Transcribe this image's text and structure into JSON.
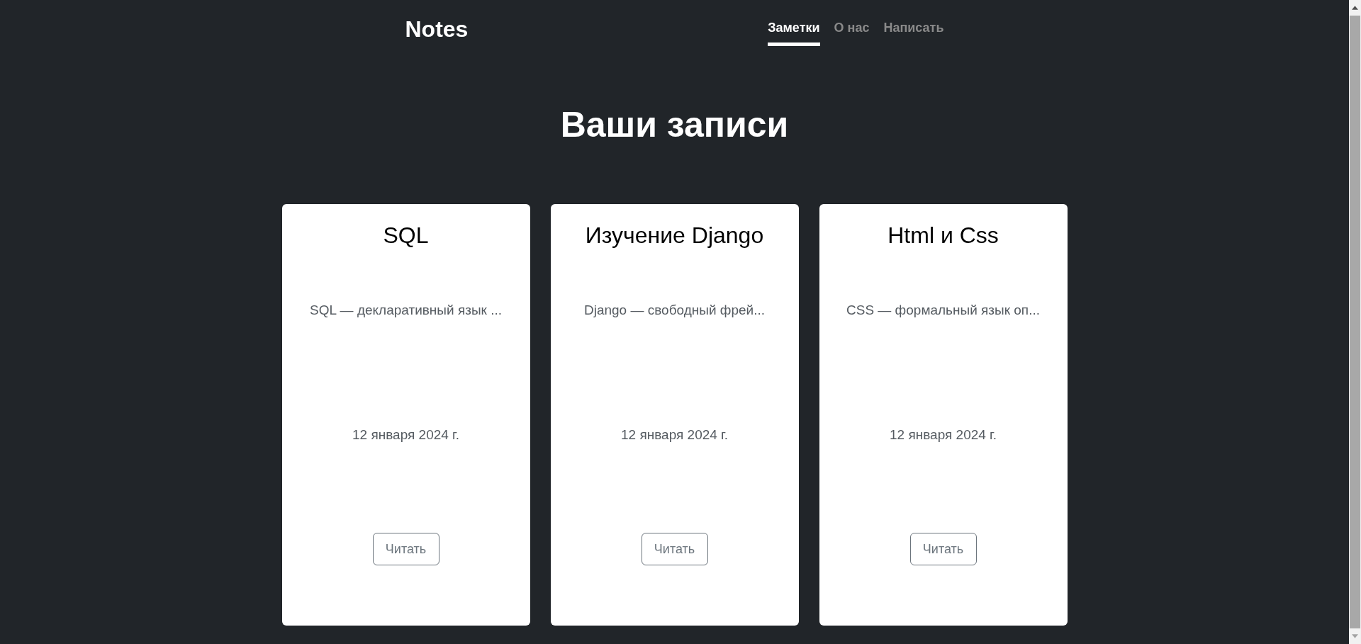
{
  "header": {
    "logo": "Notes",
    "nav": [
      {
        "label": "Заметки",
        "selected": true
      },
      {
        "label": "О нас",
        "selected": false
      },
      {
        "label": "Написать",
        "selected": false
      }
    ]
  },
  "heading": "Ваши записи",
  "notes": [
    {
      "title": "SQL",
      "excerpt": "SQL — декларативный язык ...",
      "date": "12 января 2024 г.",
      "button": "Читать"
    },
    {
      "title": "Изучение Django",
      "excerpt": "Django — свободный фрей...",
      "date": "12 января 2024 г.",
      "button": "Читать"
    },
    {
      "title": "Html и Css",
      "excerpt": "CSS — формальный язык оп...",
      "date": "12 января 2024 г.",
      "button": "Читать"
    }
  ]
}
